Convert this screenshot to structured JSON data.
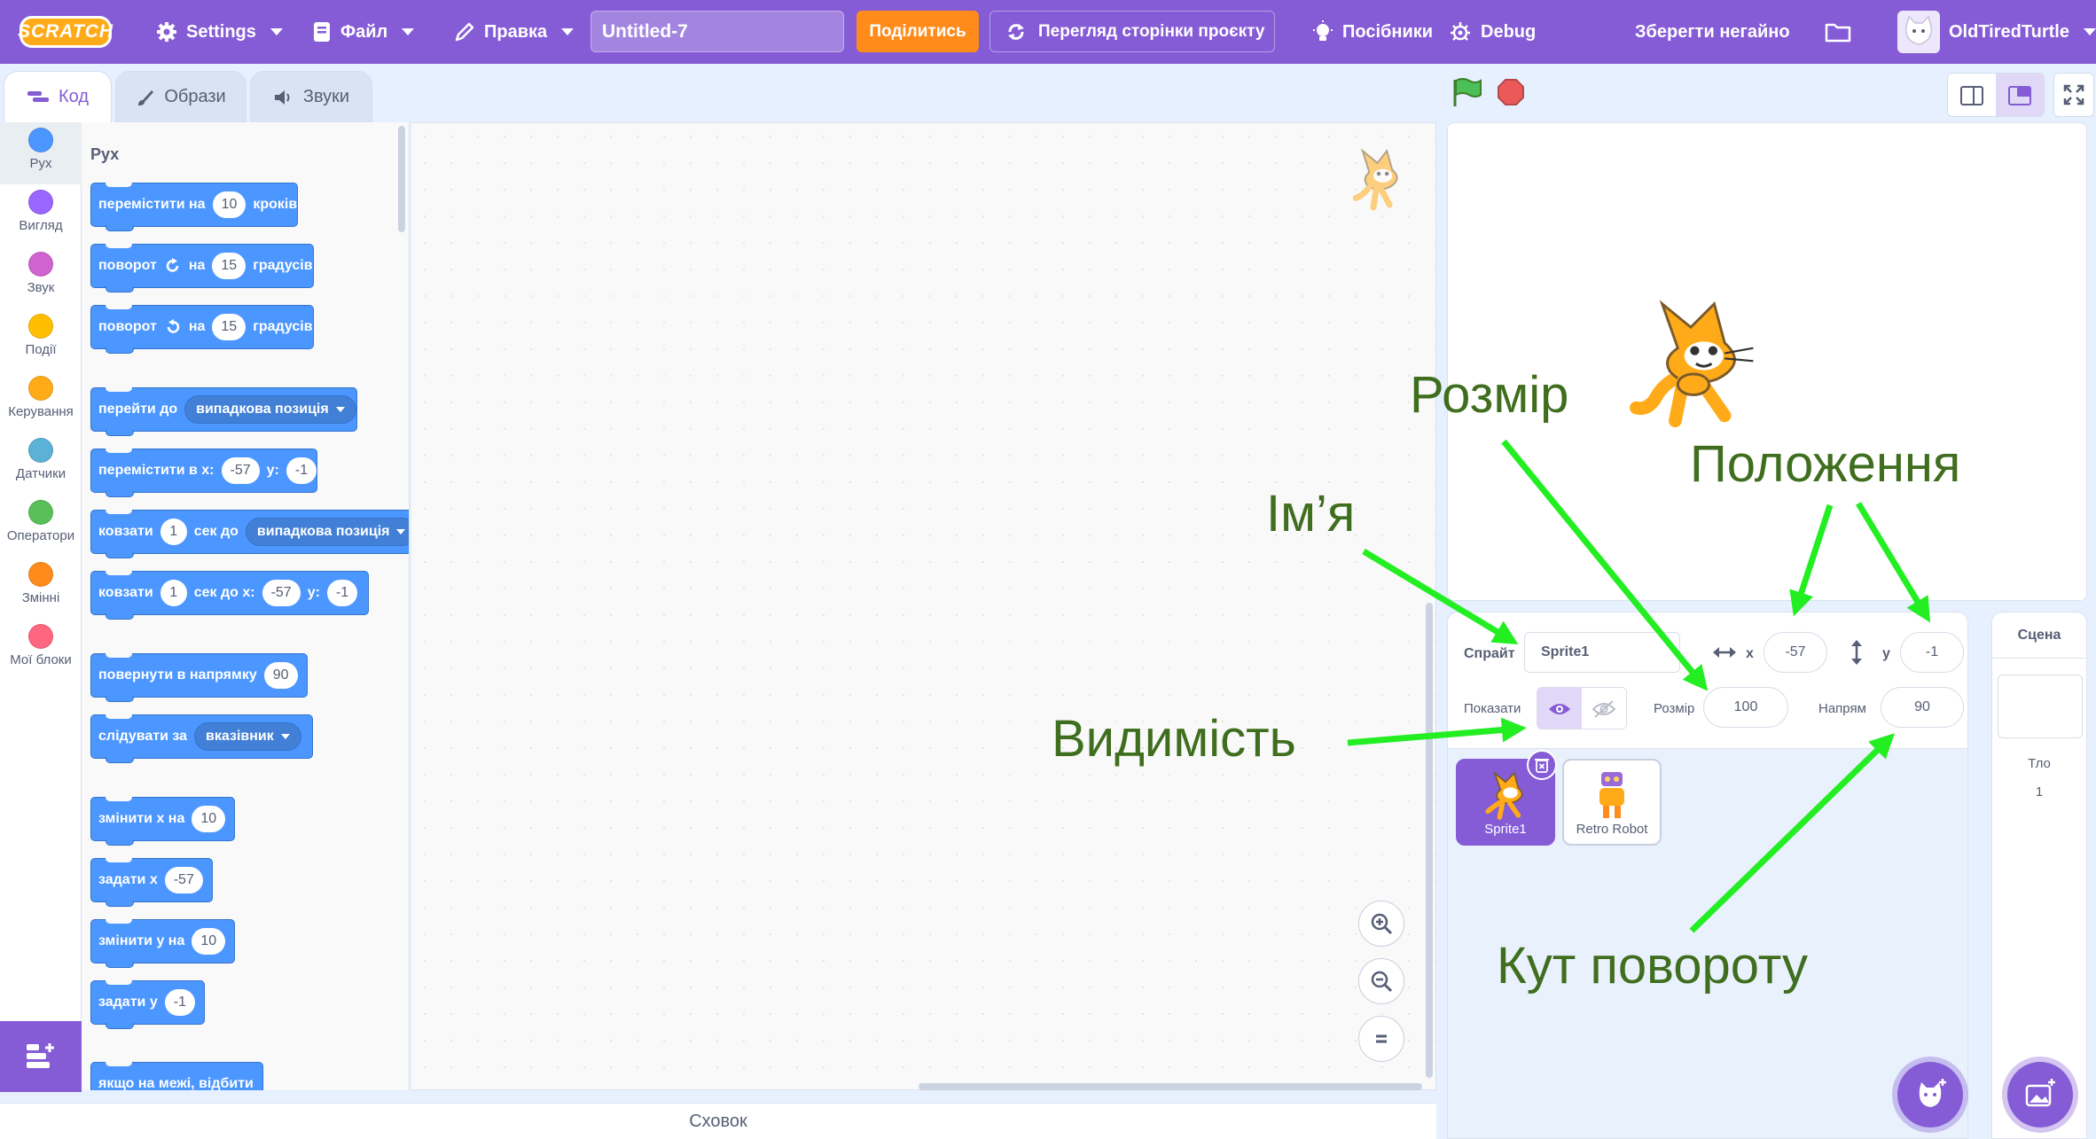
{
  "menubar": {
    "logo": "SCRATCH",
    "settings": "Settings",
    "file": "Файл",
    "edit": "Правка",
    "project_title": "Untitled-7",
    "share": "Поділитись",
    "project_page": "Перегляд сторінки проєкту",
    "tutorials": "Посібники",
    "debug": "Debug",
    "save_now": "Зберегти негайно",
    "username": "OldTiredTurtle"
  },
  "tabs": {
    "code": "Код",
    "costumes": "Образи",
    "sounds": "Звуки"
  },
  "categories": [
    {
      "label": "Рух",
      "color": "#4c97ff"
    },
    {
      "label": "Вигляд",
      "color": "#9966ff"
    },
    {
      "label": "Звук",
      "color": "#cf63cf"
    },
    {
      "label": "Події",
      "color": "#ffbf00"
    },
    {
      "label": "Керування",
      "color": "#ffab19"
    },
    {
      "label": "Датчики",
      "color": "#5cb1d6"
    },
    {
      "label": "Оператори",
      "color": "#59c059"
    },
    {
      "label": "Змінні",
      "color": "#ff8c1a"
    },
    {
      "label": "Мої блоки",
      "color": "#ff6680"
    }
  ],
  "palette": {
    "heading": "Рух",
    "blocks": {
      "move": {
        "a": "перемістити на",
        "v": "10",
        "b": "кроків"
      },
      "turn_right": {
        "a": "поворот",
        "b": "на",
        "v": "15",
        "c": "градусів"
      },
      "turn_left": {
        "a": "поворот",
        "b": "на",
        "v": "15",
        "c": "градусів"
      },
      "goto": {
        "a": "перейти до",
        "d": "випадкова позиція"
      },
      "goto_xy": {
        "a": "перемістити в x:",
        "x": "-57",
        "b": "y:",
        "y": "-1"
      },
      "glide_to": {
        "a": "ковзати",
        "v": "1",
        "b": "сек до",
        "d": "випадкова позиція"
      },
      "glide_xy": {
        "a": "ковзати",
        "v": "1",
        "b": "сек до x:",
        "x": "-57",
        "c": "y:",
        "y": "-1"
      },
      "point_dir": {
        "a": "повернути в напрямку",
        "v": "90"
      },
      "point_towards": {
        "a": "слідувати за",
        "d": "вказівник"
      },
      "change_x": {
        "a": "змінити х на",
        "v": "10"
      },
      "set_x": {
        "a": "задати х",
        "v": "-57"
      },
      "change_y": {
        "a": "змінити у на",
        "v": "10"
      },
      "set_y": {
        "a": "задати у",
        "v": "-1"
      },
      "bounce": {
        "a": "якщо на межі, відбити"
      }
    }
  },
  "backpack": "Сховок",
  "sprite_info": {
    "sprite_label": "Спрайт",
    "sprite_name": "Sprite1",
    "x_label": "x",
    "x_value": "-57",
    "y_label": "y",
    "y_value": "-1",
    "show_label": "Показати",
    "size_label": "Розмір",
    "size_value": "100",
    "direction_label": "Напрям",
    "direction_value": "90"
  },
  "sprites": [
    {
      "name": "Sprite1"
    },
    {
      "name": "Retro Robot"
    }
  ],
  "stage_pane": {
    "title": "Сцена",
    "backdrops_label": "Тло",
    "backdrops_count": "1"
  },
  "annotations": {
    "size": "Розмір",
    "position": "Положення",
    "name": "Ім’я",
    "visibility": "Видимість",
    "rotation": "Кут повороту",
    "arrow_color": "#22ee22",
    "text_color": "#3f6e1e"
  },
  "colors": {
    "menubar": "#855cd6",
    "motion": "#4c97ff",
    "share": "#ff8c1a"
  }
}
